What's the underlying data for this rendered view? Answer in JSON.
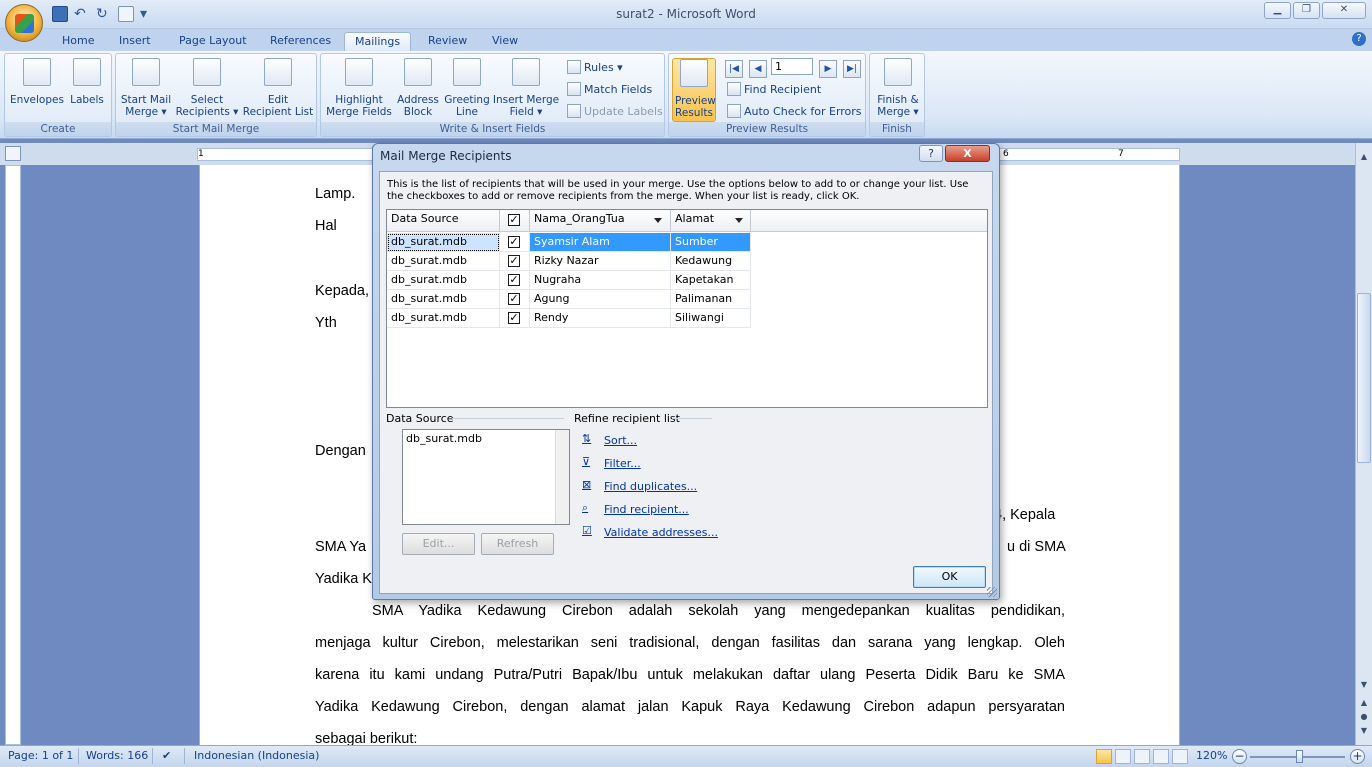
{
  "window": {
    "title": "surat2 - Microsoft Word",
    "controls": [
      "minimize",
      "restore",
      "close"
    ]
  },
  "tabs": [
    {
      "label": "Home"
    },
    {
      "label": "Insert"
    },
    {
      "label": "Page Layout"
    },
    {
      "label": "References"
    },
    {
      "label": "Mailings",
      "active": true
    },
    {
      "label": "Review"
    },
    {
      "label": "View"
    }
  ],
  "ribbon": {
    "groups": {
      "create": "Create",
      "start_mail_merge": "Start Mail Merge",
      "write_insert": "Write & Insert Fields",
      "preview": "Preview Results",
      "finish": "Finish"
    },
    "envelopes": "Envelopes",
    "labels": "Labels",
    "start_mail_merge_1": "Start Mail",
    "start_mail_merge_2": "Merge ▾",
    "select_recipients_1": "Select",
    "select_recipients_2": "Recipients ▾",
    "edit_recipient_list_1": "Edit",
    "edit_recipient_list_2": "Recipient List",
    "highlight_1": "Highlight",
    "highlight_2": "Merge Fields",
    "address_1": "Address",
    "address_2": "Block",
    "greeting_1": "Greeting",
    "greeting_2": "Line",
    "insert_merge_1": "Insert Merge",
    "insert_merge_2": "Field ▾",
    "rules": "Rules ▾",
    "match_fields": "Match Fields",
    "update_labels": "Update Labels",
    "preview_1": "Preview",
    "preview_2": "Results",
    "record_number": "1",
    "find_recipient": "Find Recipient",
    "auto_check": "Auto Check for Errors",
    "finish_1": "Finish &",
    "finish_2": "Merge ▾"
  },
  "ruler": {
    "numbers": [
      "1",
      "6",
      "7"
    ]
  },
  "document": {
    "lines": [
      "Lamp.",
      "Hal",
      "Kepada,",
      "Yth",
      "Dengan",
      "4, Kepala",
      "SMA Ya",
      "u di SMA",
      "Yadika K"
    ],
    "paragraph": [
      "SMA Yadika Kedawung Cirebon adalah sekolah yang mengedepankan kualitas pendidikan,",
      "menjaga kultur Cirebon, melestarikan seni tradisional, dengan fasilitas dan sarana yang lengkap. Oleh",
      "karena itu kami undang Putra/Putri Bapak/Ibu untuk melakukan daftar ulang Peserta Didik Baru ke SMA",
      "Yadika Kedawung Cirebon, dengan alamat jalan Kapuk Raya Kedawung Cirebon adapun persyaratan",
      "sebagai berikut:"
    ]
  },
  "dialog": {
    "title": "Mail Merge Recipients",
    "help_label": "?",
    "close_label": "X",
    "description": "This is the list of recipients that will be used in your merge.  Use the options below to add to or change your list.  Use the checkboxes to add or remove recipients from the merge.  When your list is ready, click OK.",
    "columns": [
      "Data Source",
      "Nama_OrangTua",
      "Alamat"
    ],
    "rows": [
      {
        "source": "db_surat.mdb",
        "checked": true,
        "nama": "Syamsir Alam",
        "alamat": "Sumber",
        "selected": true
      },
      {
        "source": "db_surat.mdb",
        "checked": true,
        "nama": "Rizky Nazar",
        "alamat": "Kedawung"
      },
      {
        "source": "db_surat.mdb",
        "checked": true,
        "nama": "Nugraha",
        "alamat": "Kapetakan"
      },
      {
        "source": "db_surat.mdb",
        "checked": true,
        "nama": "Agung",
        "alamat": "Palimanan"
      },
      {
        "source": "db_surat.mdb",
        "checked": true,
        "nama": "Rendy",
        "alamat": "Siliwangi"
      }
    ],
    "data_source_label": "Data Source",
    "data_source_item": "db_surat.mdb",
    "edit_btn": "Edit...",
    "refresh_btn": "Refresh",
    "refine_label": "Refine recipient list",
    "refine_links": [
      "Sort...",
      "Filter...",
      "Find duplicates...",
      "Find recipient...",
      "Validate addresses..."
    ],
    "ok_btn": "OK"
  },
  "statusbar": {
    "page": "Page: 1 of 1",
    "words": "Words: 166",
    "language": "Indonesian (Indonesia)",
    "zoom": "120%",
    "zoom_out": "−",
    "zoom_in": "+"
  }
}
